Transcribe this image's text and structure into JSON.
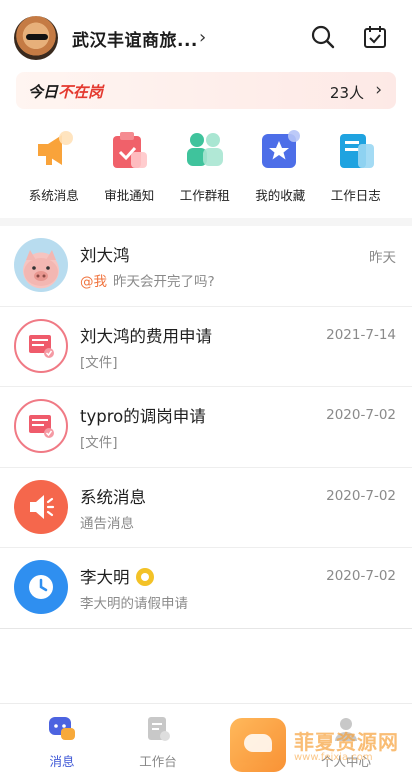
{
  "header": {
    "company_name": "武汉丰谊商旅...",
    "chevron": "›",
    "icons": [
      "search-icon",
      "calendar-check-icon"
    ]
  },
  "absent_banner": {
    "prefix": "今日",
    "highlight": "不在岗",
    "count": "23人",
    "chevron": "›",
    "colors": {
      "highlight": "#e4392f"
    }
  },
  "quick_entries": [
    {
      "label": "系统消息",
      "icon": "megaphone-icon"
    },
    {
      "label": "审批通知",
      "icon": "clipboard-check-icon"
    },
    {
      "label": "工作群租",
      "icon": "group-icon"
    },
    {
      "label": "我的收藏",
      "icon": "star-icon"
    },
    {
      "label": "工作日志",
      "icon": "journal-icon"
    }
  ],
  "messages": [
    {
      "title": "刘大鸿",
      "mention": "@我",
      "subtitle": "昨天会开完了吗?",
      "time": "昨天",
      "avatar": "pig-avatar"
    },
    {
      "title": "刘大鸿的费用申请",
      "subtitle": "[文件]",
      "time": "2021-7-14",
      "avatar": "expense-form-icon"
    },
    {
      "title": "typro的调岗申请",
      "subtitle": "[文件]",
      "time": "2020-7-02",
      "avatar": "transfer-form-icon"
    },
    {
      "title": "系统消息",
      "subtitle": "通告消息",
      "time": "2020-7-02",
      "avatar": "speaker-icon"
    },
    {
      "title": "李大明",
      "subtitle": "李大明的请假申请",
      "time": "2020-7-02",
      "avatar": "clock-icon"
    }
  ],
  "tabbar": {
    "tabs": [
      {
        "label": "消息",
        "active": true
      },
      {
        "label": "工作台",
        "active": false
      },
      {
        "label": "",
        "active": false
      },
      {
        "label": "个人中心",
        "active": false
      }
    ],
    "colors": {
      "active": "#3f58d6",
      "inactive": "#888888"
    }
  },
  "watermark": {
    "text": "菲夏资源网",
    "subtitle": "www.feixia.com"
  }
}
